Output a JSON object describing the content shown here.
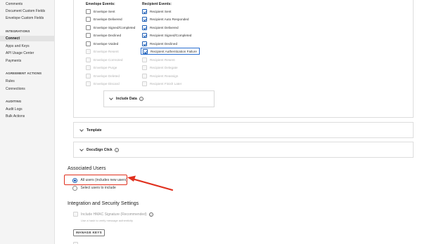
{
  "sidebar": {
    "top_items": [
      "Comments",
      "Document Custom Fields",
      "Envelope Custom Fields"
    ],
    "sections": [
      {
        "heading": "INTEGRATIONS",
        "items": [
          "Connect",
          "Apps and Keys",
          "API Usage Center",
          "Payments"
        ]
      },
      {
        "heading": "AGREEMENT ACTIONS",
        "items": [
          "Rules",
          "Connections"
        ]
      },
      {
        "heading": "AUDITING",
        "items": [
          "Audit Logs",
          "Bulk Actions"
        ]
      }
    ],
    "active_item": "Connect"
  },
  "events": {
    "envelope_heading": "Envelope Events:",
    "recipient_heading": "Recipient Events:",
    "envelope": [
      {
        "label": "Envelope Sent",
        "checked": false,
        "disabled": false
      },
      {
        "label": "Envelope Delivered",
        "checked": false,
        "disabled": false
      },
      {
        "label": "Envelope Signed/Completed",
        "checked": false,
        "disabled": false
      },
      {
        "label": "Envelope Declined",
        "checked": false,
        "disabled": false
      },
      {
        "label": "Envelope Voided",
        "checked": false,
        "disabled": false
      },
      {
        "label": "Envelope Resent",
        "checked": false,
        "disabled": true
      },
      {
        "label": "Envelope Corrected",
        "checked": false,
        "disabled": true
      },
      {
        "label": "Envelope Purge",
        "checked": false,
        "disabled": true
      },
      {
        "label": "Envelope Deleted",
        "checked": false,
        "disabled": true
      },
      {
        "label": "Envelope Discard",
        "checked": false,
        "disabled": true
      }
    ],
    "recipient": [
      {
        "label": "Recipient Sent",
        "checked": true,
        "disabled": false
      },
      {
        "label": "Recipient Auto Responded",
        "checked": true,
        "disabled": false
      },
      {
        "label": "Recipient Delivered",
        "checked": true,
        "disabled": false
      },
      {
        "label": "Recipient Signed/Completed",
        "checked": true,
        "disabled": false
      },
      {
        "label": "Recipient Declined",
        "checked": true,
        "disabled": false
      },
      {
        "label": "Recipient Authentication Failure",
        "checked": true,
        "disabled": false
      },
      {
        "label": "Recipient Resent",
        "checked": false,
        "disabled": true
      },
      {
        "label": "Recipient Delegate",
        "checked": false,
        "disabled": true
      },
      {
        "label": "Recipient Reassign",
        "checked": false,
        "disabled": true
      },
      {
        "label": "Recipient Finish Later",
        "checked": false,
        "disabled": true
      }
    ],
    "include_data_label": "Include Data"
  },
  "accordions": {
    "template_label": "Template",
    "docusign_click_label": "DocuSign Click"
  },
  "associated_users": {
    "heading": "Associated Users",
    "options": [
      {
        "label": "All users (includes new users)",
        "selected": true
      },
      {
        "label": "Select users to include",
        "selected": false
      }
    ]
  },
  "security": {
    "heading": "Integration and Security Settings",
    "hmac_label": "Include HMAC Signature (Recommended)",
    "hmac_hint": "Use a hash to verify message authenticity",
    "manage_keys_label": "MANAGE KEYS"
  },
  "icons": {
    "help": "question-circle-icon",
    "chevron": "chevron-down-icon",
    "annotation": "red-arrow-icon"
  },
  "colors": {
    "accent": "#1e5fb6",
    "annotation": "#e0301e"
  }
}
